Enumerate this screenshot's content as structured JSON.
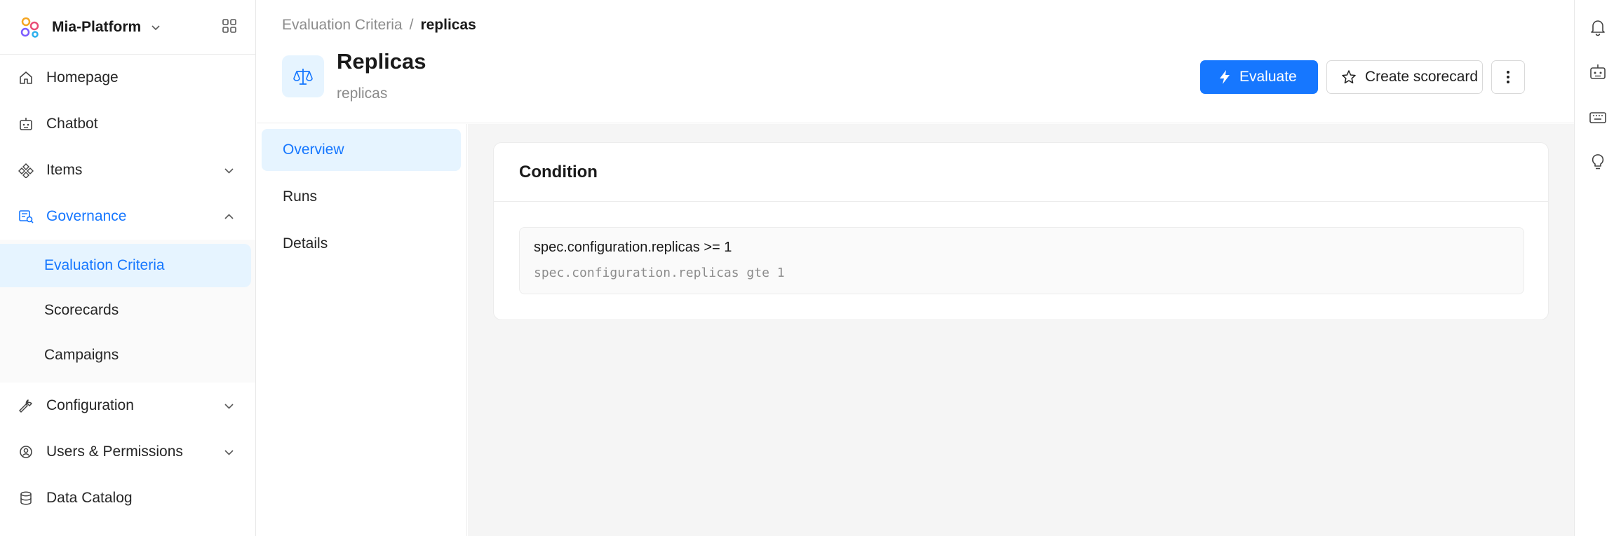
{
  "brand": {
    "name": "Mia-Platform"
  },
  "sidebar": {
    "items": [
      {
        "label": "Homepage",
        "icon": "home-icon"
      },
      {
        "label": "Chatbot",
        "icon": "robot-icon"
      },
      {
        "label": "Items",
        "icon": "diamond-grid-icon",
        "expandable": true
      },
      {
        "label": "Governance",
        "icon": "governance-icon",
        "expanded": true,
        "children": [
          {
            "label": "Evaluation Criteria",
            "selected": true
          },
          {
            "label": "Scorecards"
          },
          {
            "label": "Campaigns"
          }
        ]
      },
      {
        "label": "Configuration",
        "icon": "wrench-icon",
        "expandable": true
      },
      {
        "label": "Users & Permissions",
        "icon": "user-gear-icon",
        "expandable": true
      },
      {
        "label": "Data Catalog",
        "icon": "database-icon"
      }
    ]
  },
  "header": {
    "breadcrumb": {
      "parent": "Evaluation Criteria",
      "separator": "/",
      "current": "replicas"
    },
    "title": "Replicas",
    "subtitle": "replicas",
    "actions": {
      "evaluate": "Evaluate",
      "create_scorecard": "Create scorecard"
    }
  },
  "tabs": [
    {
      "label": "Overview",
      "selected": true
    },
    {
      "label": "Runs"
    },
    {
      "label": "Details"
    }
  ],
  "condition": {
    "title": "Condition",
    "expression": "spec.configuration.replicas >= 1",
    "code": "spec.configuration.replicas gte 1"
  },
  "colors": {
    "accent": "#1677ff",
    "selected_bg": "#e6f4ff",
    "content_bg": "#f5f5f5"
  },
  "right_rail": [
    "bell-icon",
    "robot-icon",
    "keyboard-icon",
    "lightbulb-icon"
  ]
}
